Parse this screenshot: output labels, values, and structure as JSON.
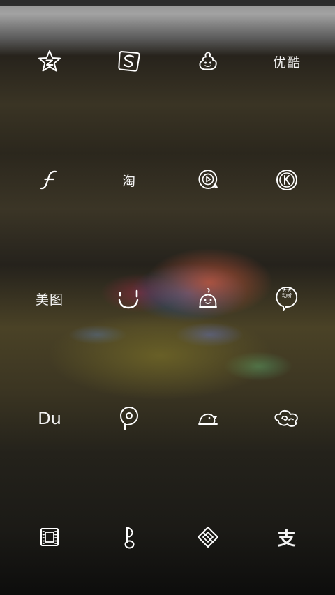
{
  "apps": [
    {
      "id": "qq-zone",
      "icon": "star-z-icon"
    },
    {
      "id": "sogou",
      "icon": "sogou-s-icon"
    },
    {
      "id": "poop",
      "icon": "poop-icon"
    },
    {
      "id": "youku",
      "label": "优酷"
    },
    {
      "id": "flash",
      "icon": "flash-f-icon"
    },
    {
      "id": "taobao",
      "label": "淘"
    },
    {
      "id": "video-play",
      "icon": "play-bubble-icon"
    },
    {
      "id": "kugou",
      "icon": "k-circle-icon"
    },
    {
      "id": "meitu",
      "label": "美图"
    },
    {
      "id": "smile",
      "icon": "smile-icon"
    },
    {
      "id": "baby",
      "icon": "baby-head-icon"
    },
    {
      "id": "tiantian",
      "label": "天天\n动听"
    },
    {
      "id": "du",
      "label": "Du"
    },
    {
      "id": "location-pin",
      "icon": "map-pin-icon"
    },
    {
      "id": "bird",
      "icon": "bird-icon"
    },
    {
      "id": "cloud",
      "icon": "cloud-swirl-icon"
    },
    {
      "id": "film",
      "icon": "film-strip-icon"
    },
    {
      "id": "music-note",
      "icon": "music-note-icon"
    },
    {
      "id": "diamond",
      "icon": "diamond-icon"
    },
    {
      "id": "alipay",
      "label": "支"
    }
  ]
}
